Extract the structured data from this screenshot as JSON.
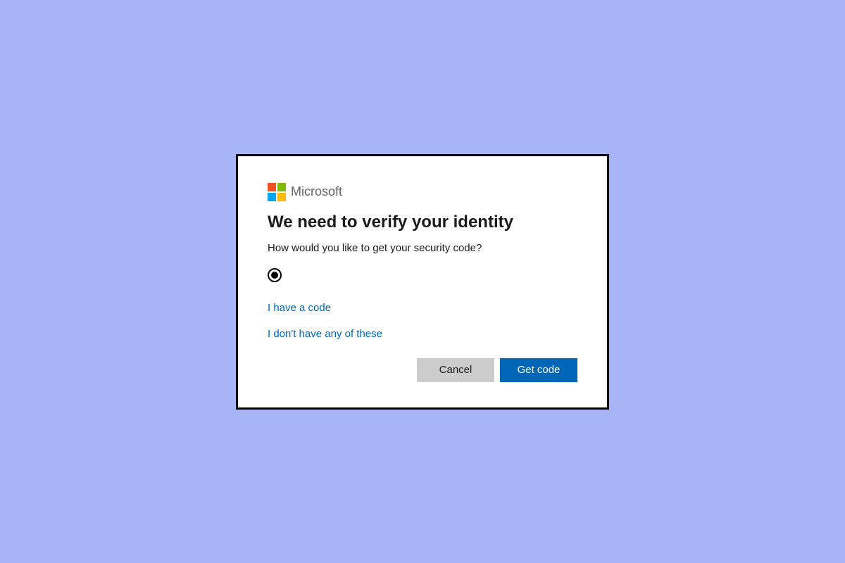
{
  "brand": {
    "label": "Microsoft",
    "colors": {
      "q1": "#f25022",
      "q2": "#7fba00",
      "q3": "#00a4ef",
      "q4": "#ffb900"
    }
  },
  "dialog": {
    "heading": "We need to verify your identity",
    "subtext": "How would you like to get your security code?"
  },
  "options": {
    "selected_label": ""
  },
  "links": {
    "have_code": "I have a code",
    "none_of_these": "I don't have any of these"
  },
  "buttons": {
    "cancel": "Cancel",
    "get_code": "Get code"
  },
  "colors": {
    "page_bg": "#a7b5f7",
    "link": "#0067b8",
    "primary": "#0067b8",
    "secondary": "#cccccc"
  }
}
